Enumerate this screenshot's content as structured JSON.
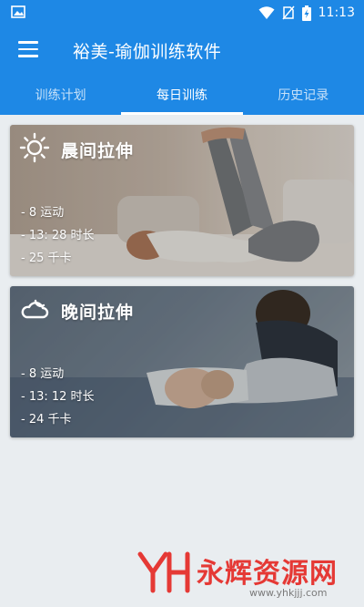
{
  "status_bar": {
    "time": "11:13"
  },
  "app_bar": {
    "title": "裕美-瑜伽训练软件"
  },
  "tabs": [
    {
      "label": "训练计划",
      "active": false
    },
    {
      "label": "每日训练",
      "active": true
    },
    {
      "label": "历史记录",
      "active": false
    }
  ],
  "cards": [
    {
      "title": "晨间拉伸",
      "icon": "sun-icon",
      "stats": [
        "- 8 运动",
        "- 13: 28 时长",
        "- 25 千卡"
      ]
    },
    {
      "title": "晚间拉伸",
      "icon": "moon-cloud-icon",
      "stats": [
        "- 8 运动",
        "- 13: 12 时长",
        "- 24 千卡"
      ]
    }
  ],
  "watermark": {
    "brand": "永辉资源网",
    "url": "www.yhkjjj.com"
  },
  "colors": {
    "primary": "#1e88e5",
    "background": "#e9edf0",
    "watermark": "#e53935"
  }
}
